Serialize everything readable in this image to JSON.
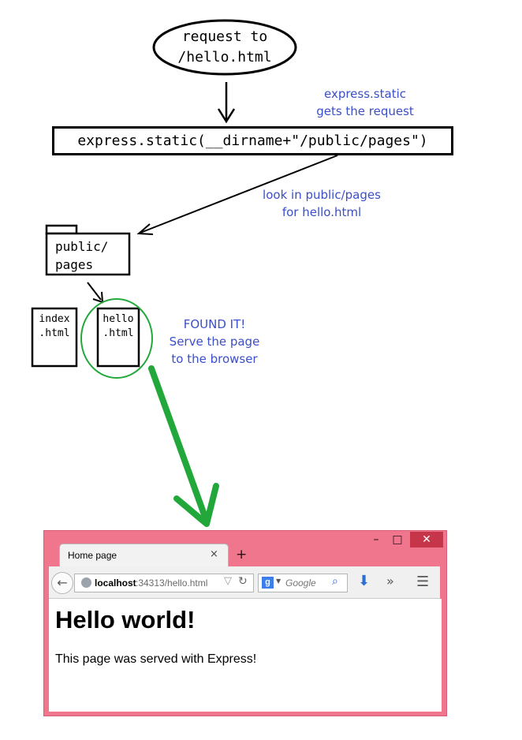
{
  "flow": {
    "request_line1": "request to",
    "request_line2": "/hello.html",
    "static_call": "express.static(__dirname+\"/public/pages\")",
    "note1_line1": "express.static",
    "note1_line2": "gets the request",
    "note2_line1": "look in public/pages",
    "note2_line2": "for hello.html",
    "folder_line1": "public/",
    "folder_line2": "pages",
    "file_index_line1": "index",
    "file_index_line2": ".html",
    "file_hello_line1": "hello",
    "file_hello_line2": ".html",
    "note3_line1": "FOUND IT!",
    "note3_line2": "Serve the page",
    "note3_line3": "to the browser",
    "colors": {
      "note": "#3b4fc8",
      "found": "#22a83a",
      "browser_frame": "#f0768e"
    }
  },
  "browser": {
    "tab_title": "Home page",
    "tab_close": "×",
    "new_tab": "+",
    "win_minimize": "–",
    "win_maximize": "□",
    "win_close": "✕",
    "back": "←",
    "url_host": "localhost",
    "url_rest": ":34313/hello.html",
    "search_engine": "g",
    "search_placeholder": "Google",
    "icons": [
      "back-icon",
      "globe-icon",
      "star-icon",
      "reload-icon",
      "google-icon",
      "search-icon",
      "download-icon",
      "overflow-icon",
      "menu-icon"
    ]
  },
  "page": {
    "heading": "Hello world!",
    "paragraph": "This page was served with Express!"
  }
}
